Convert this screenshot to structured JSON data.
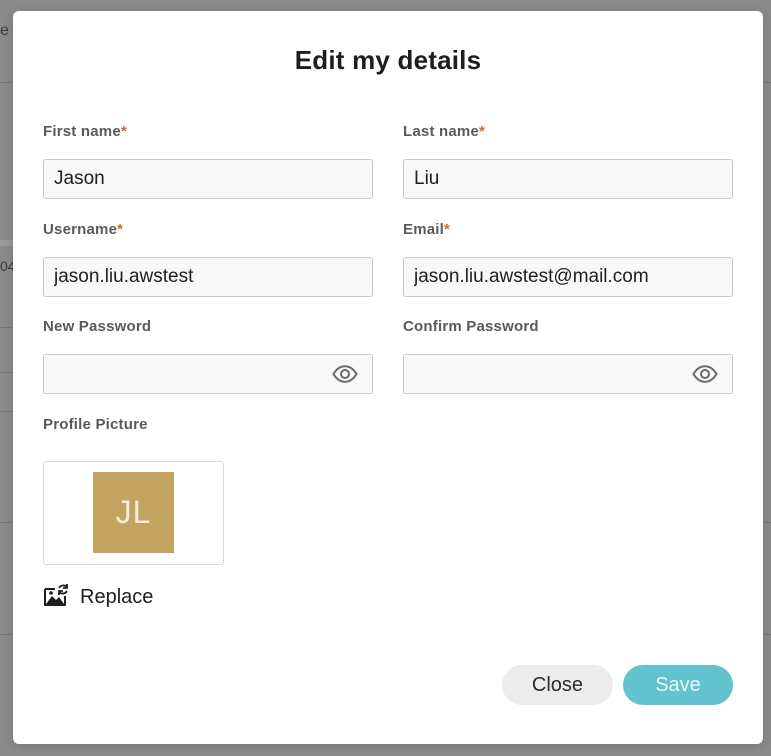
{
  "background": {
    "fragment_top": "e",
    "fragment_mid": "04"
  },
  "modal": {
    "title": "Edit my details",
    "required_marker": "*",
    "fields": {
      "first_name": {
        "label": "First name",
        "value": "Jason",
        "required": true
      },
      "last_name": {
        "label": "Last name",
        "value": "Liu",
        "required": true
      },
      "username": {
        "label": "Username",
        "value": "jason.liu.awstest",
        "required": true
      },
      "email": {
        "label": "Email",
        "value": "jason.liu.awstest@mail.com",
        "required": true
      },
      "new_password": {
        "label": "New Password",
        "value": "",
        "icon": "eye-icon"
      },
      "confirm_password": {
        "label": "Confirm Password",
        "value": "",
        "icon": "eye-icon"
      }
    },
    "profile_picture": {
      "label": "Profile Picture",
      "initials": "JL",
      "avatar_color": "#c2a35f",
      "replace_label": "Replace",
      "replace_icon": "image-replace-icon"
    },
    "buttons": {
      "close_label": "Close",
      "save_label": "Save",
      "save_color": "#62c3cf",
      "close_color": "#ececec"
    }
  }
}
